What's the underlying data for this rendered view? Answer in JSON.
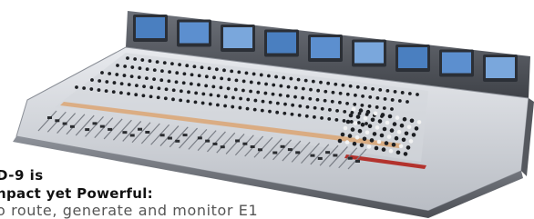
{
  "caption": {
    "line1": "D-9 is",
    "line2": "npact yet Powerful:",
    "line3": "o route, generate and monitor E1"
  },
  "console": {
    "screen_count": 9,
    "fader_count": 34,
    "colors": {
      "frame": "#9a9ea6",
      "frame_dark": "#5f636a",
      "surface": "#cfd2d8",
      "surface_light": "#e6e8ec",
      "screen_bezel": "#2b2f36",
      "screen_glass": "#3a6db0",
      "knob": "#1d1f23",
      "accent_red": "#b3322d",
      "accent_orange": "#e08b3a"
    }
  }
}
